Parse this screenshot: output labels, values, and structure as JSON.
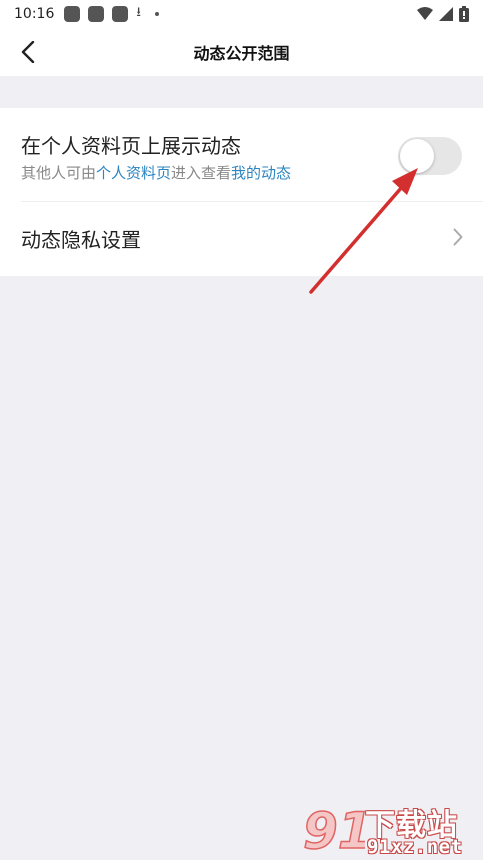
{
  "status_bar": {
    "time": "10:16",
    "icons": [
      "app-notification-icon",
      "app-notification-icon",
      "app-notification-icon",
      "download-icon",
      "dot-icon",
      "wifi-icon",
      "signal-icon",
      "battery-icon"
    ]
  },
  "header": {
    "back_icon": "chevron-left-icon",
    "title": "动态公开范围"
  },
  "settings": {
    "show_feed": {
      "label": "在个人资料页上展示动态",
      "desc_part1": "其他人可由",
      "desc_link1": "个人资料页",
      "desc_part2": "进入查看",
      "desc_link2": "我的动态",
      "toggle_on": false
    },
    "privacy": {
      "label": "动态隐私设置",
      "chevron_icon": "chevron-right-icon"
    }
  },
  "colors": {
    "background": "#f0f0f4",
    "link": "#2e86c1",
    "toggle_off": "#e6e6e6",
    "annotation_arrow": "#d32f2f"
  },
  "watermark": {
    "logo_text": "91",
    "line1": "下载站",
    "line2": "91xz.net"
  }
}
